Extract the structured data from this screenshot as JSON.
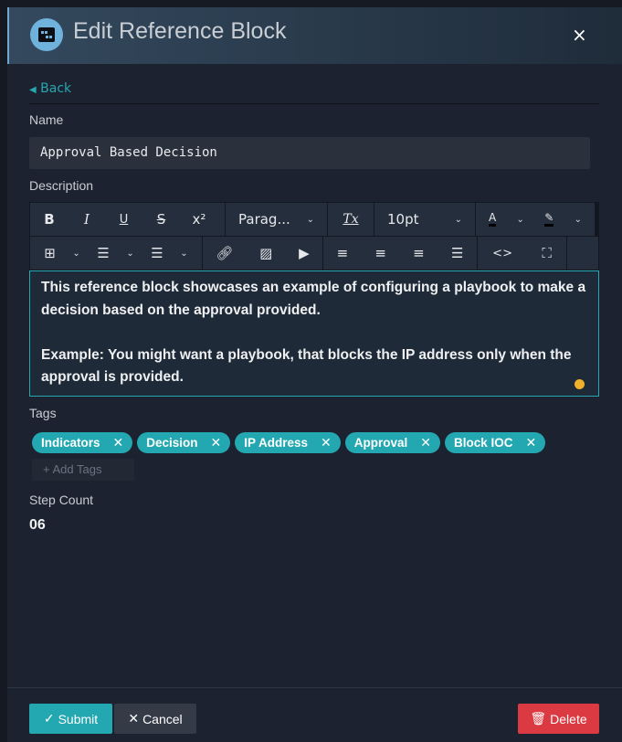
{
  "header": {
    "title": "Edit Reference Block",
    "close": "×"
  },
  "back": "Back",
  "name": {
    "label": "Name",
    "value": "Approval Based Decision"
  },
  "description": {
    "label": "Description",
    "toolbar": {
      "bold": "B",
      "italic": "I",
      "underline": "U",
      "strike": "S",
      "superscript": "x²",
      "block_format": "Parag...",
      "clear_format": "Tx",
      "font_size": "10pt",
      "text_color": "A"
    },
    "paragraphs": [
      "This reference block showcases an example of configuring a playbook to make a decision based on the approval provided.",
      "",
      "Example: You might want a playbook, that blocks the IP address only when the approval is provided."
    ]
  },
  "tags": {
    "label": "Tags",
    "items": [
      "Indicators",
      "Decision",
      "IP Address",
      "Approval",
      "Block IOC"
    ],
    "add_placeholder": "+ Add Tags"
  },
  "step_count": {
    "label": "Step Count",
    "value": "06"
  },
  "footer": {
    "submit": "Submit",
    "cancel": "Cancel",
    "delete": "Delete"
  },
  "colors": {
    "accent": "#25a8b0",
    "danger": "#dc3a43",
    "cancel": "#343a46"
  }
}
